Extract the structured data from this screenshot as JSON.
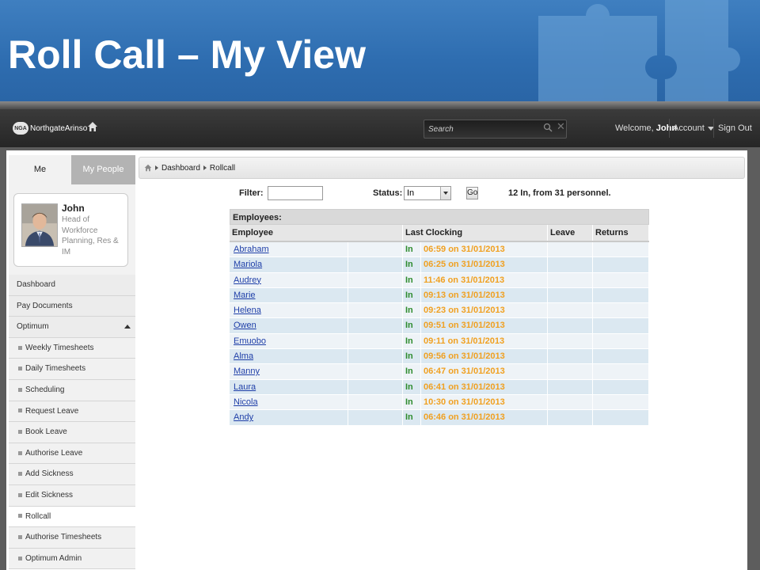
{
  "slide": {
    "title": "Roll Call – My View"
  },
  "topbar": {
    "logo_text": "NorthgateArinso",
    "logo_badge": "NGA",
    "search_placeholder": "Search",
    "welcome_prefix": "Welcome,",
    "user_name": "John",
    "account_label": "Account",
    "signout_label": "Sign Out"
  },
  "sidebar": {
    "tabs": [
      {
        "label": "Me"
      },
      {
        "label": "My People"
      }
    ],
    "profile": {
      "name": "John",
      "role": "Head of Workforce Planning, Res & IM"
    },
    "nav": [
      {
        "label": "Dashboard",
        "sub": false
      },
      {
        "label": "Pay Documents",
        "sub": false
      },
      {
        "label": "Optimum",
        "sub": false,
        "expanded": true
      },
      {
        "label": "Weekly Timesheets",
        "sub": true
      },
      {
        "label": "Daily Timesheets",
        "sub": true
      },
      {
        "label": "Scheduling",
        "sub": true
      },
      {
        "label": "Request Leave",
        "sub": true
      },
      {
        "label": "Book Leave",
        "sub": true
      },
      {
        "label": "Authorise Leave",
        "sub": true
      },
      {
        "label": "Add Sickness",
        "sub": true
      },
      {
        "label": "Edit Sickness",
        "sub": true
      },
      {
        "label": "Rollcall",
        "sub": true,
        "active": true
      },
      {
        "label": "Authorise Timesheets",
        "sub": true
      },
      {
        "label": "Optimum Admin",
        "sub": true
      }
    ]
  },
  "breadcrumb": {
    "items": [
      "Dashboard",
      "Rollcall"
    ]
  },
  "filters": {
    "filter_label": "Filter:",
    "filter_value": "",
    "status_label": "Status:",
    "status_value": "In",
    "go_label": "Go",
    "summary": "12 In, from 31 personnel."
  },
  "table": {
    "caption": "Employees:",
    "columns": [
      "Employee",
      "Last Clocking",
      "Leave",
      "Returns"
    ],
    "rows": [
      {
        "name": "Abraham",
        "status": "In",
        "time": "06:59 on 31/01/2013",
        "leave": "",
        "returns": ""
      },
      {
        "name": "Mariola",
        "status": "In",
        "time": "06:25 on 31/01/2013",
        "leave": "",
        "returns": ""
      },
      {
        "name": "Audrey",
        "status": "In",
        "time": "11:46 on 31/01/2013",
        "leave": "",
        "returns": ""
      },
      {
        "name": "Marie",
        "status": "In",
        "time": "09:13 on 31/01/2013",
        "leave": "",
        "returns": ""
      },
      {
        "name": "Helena",
        "status": "In",
        "time": "09:23 on 31/01/2013",
        "leave": "",
        "returns": ""
      },
      {
        "name": "Owen",
        "status": "In",
        "time": "09:51 on 31/01/2013",
        "leave": "",
        "returns": ""
      },
      {
        "name": "Emuobo",
        "status": "In",
        "time": "09:11 on 31/01/2013",
        "leave": "",
        "returns": ""
      },
      {
        "name": "Alma",
        "status": "In",
        "time": "09:56 on 31/01/2013",
        "leave": "",
        "returns": ""
      },
      {
        "name": "Manny",
        "status": "In",
        "time": "06:47 on 31/01/2013",
        "leave": "",
        "returns": ""
      },
      {
        "name": "Laura",
        "status": "In",
        "time": "06:41 on 31/01/2013",
        "leave": "",
        "returns": ""
      },
      {
        "name": "Nicola",
        "status": "In",
        "time": "10:30 on 31/01/2013",
        "leave": "",
        "returns": ""
      },
      {
        "name": "Andy",
        "status": "In",
        "time": "06:46 on 31/01/2013",
        "leave": "",
        "returns": ""
      }
    ]
  }
}
